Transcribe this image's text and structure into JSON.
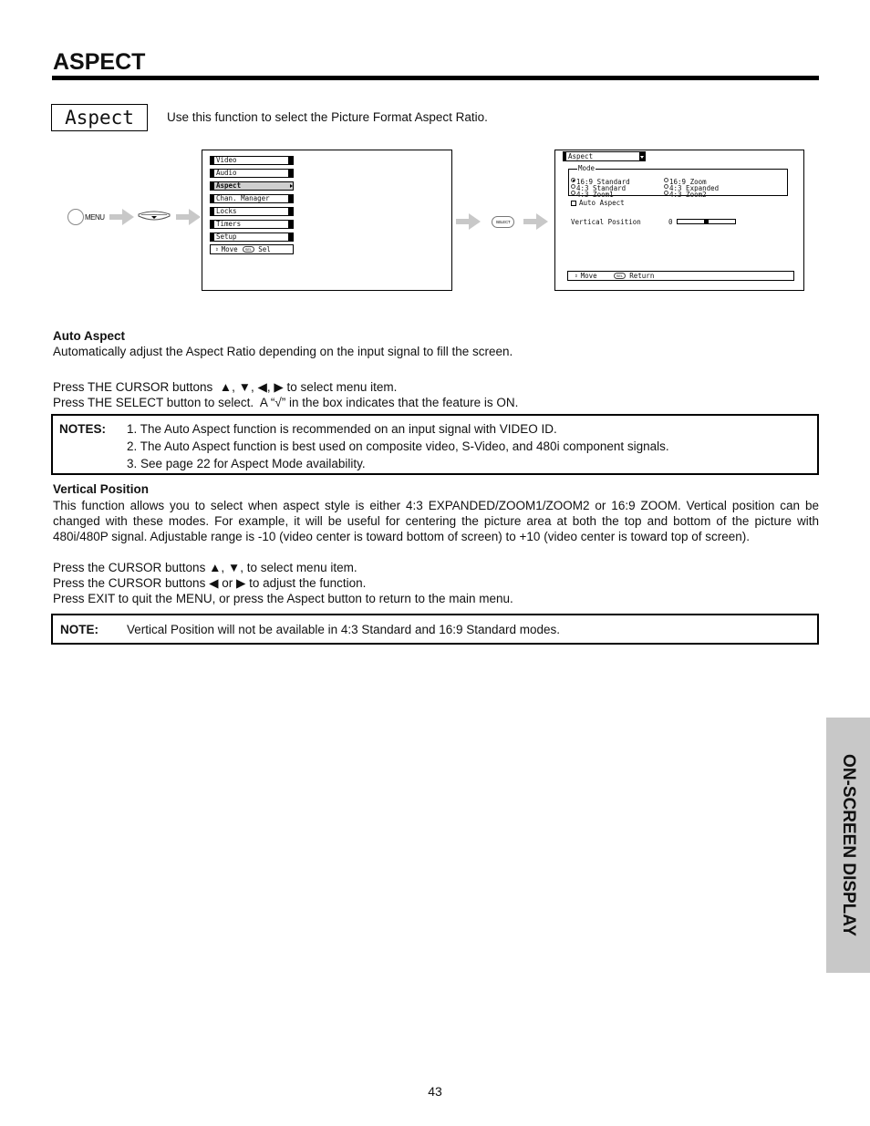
{
  "header": {
    "title": "ASPECT"
  },
  "intro": {
    "label": "Aspect",
    "description": "Use this function to select the Picture Format Aspect Ratio."
  },
  "steps": {
    "menu_button_label": "MENU",
    "select_button_label": "SELECT"
  },
  "main_menu": {
    "items": [
      {
        "label": "Video",
        "selected": false
      },
      {
        "label": "Audio",
        "selected": false
      },
      {
        "label": "Aspect",
        "selected": true
      },
      {
        "label": "Chan. Manager",
        "selected": false
      },
      {
        "label": "Locks",
        "selected": false
      },
      {
        "label": "Timers",
        "selected": false
      },
      {
        "label": "Setup",
        "selected": false
      }
    ],
    "footer": {
      "move_label": "Move",
      "sel_icon_label": "SEL",
      "sel_label": "Sel"
    }
  },
  "aspect_menu": {
    "title": "Aspect",
    "mode_group_label": "Mode",
    "modes": [
      {
        "label": "16:9 Standard",
        "selected": true
      },
      {
        "label": "16:9 Zoom",
        "selected": false
      },
      {
        "label": "4:3 Standard",
        "selected": false
      },
      {
        "label": "4:3 Expanded",
        "selected": false
      },
      {
        "label": "4:3 Zoom1",
        "selected": false
      },
      {
        "label": "4:3 Zoom2",
        "selected": false
      }
    ],
    "auto_aspect_label": "Auto Aspect",
    "auto_aspect_checked": false,
    "vertical_position_label": "Vertical Position",
    "vertical_position_value": "0",
    "vertical_position_range": [
      -10,
      10
    ],
    "footer": {
      "move_label": "Move",
      "sel_icon_label": "SEL",
      "return_label": "Return"
    }
  },
  "auto_aspect_section": {
    "heading": "Auto Aspect",
    "description": "Automatically adjust the Aspect Ratio depending on the input signal to fill the screen.",
    "instructions": [
      "Press THE CURSOR buttons  ▲, ▼, ◀, ▶ to select menu item.",
      "Press THE SELECT button to select.  A “√” in the box indicates that the feature is ON."
    ]
  },
  "notes": {
    "label": "NOTES:",
    "items": [
      "1. The Auto Aspect function is recommended on an input signal with VIDEO ID.",
      "2. The Auto Aspect function is best used on composite video, S-Video, and 480i component signals.",
      "3. See page 22 for Aspect Mode availability."
    ]
  },
  "vertical_position_section": {
    "heading": "Vertical Position",
    "description": "This function allows you to select when aspect style is either 4:3 EXPANDED/ZOOM1/ZOOM2 or 16:9 ZOOM.  Vertical position can be changed with these modes.  For example, it will be useful for centering the picture area at both the top and bottom of the picture with 480i/480P signal.  Adjustable range is -10 (video center is toward bottom of screen) to +10 (video center is toward top of screen).",
    "instructions": [
      "Press the CURSOR buttons ▲, ▼, to select menu item.",
      "Press the CURSOR buttons ◀ or ▶ to adjust the function.",
      "Press EXIT to quit the MENU, or press the Aspect button to return to the main menu."
    ]
  },
  "note": {
    "label": "NOTE:",
    "text": "Vertical Position will not be available in 4:3 Standard and 16:9 Standard modes."
  },
  "side_tab": {
    "label": "ON-SCREEN DISPLAY"
  },
  "footer": {
    "page_number": "43"
  }
}
